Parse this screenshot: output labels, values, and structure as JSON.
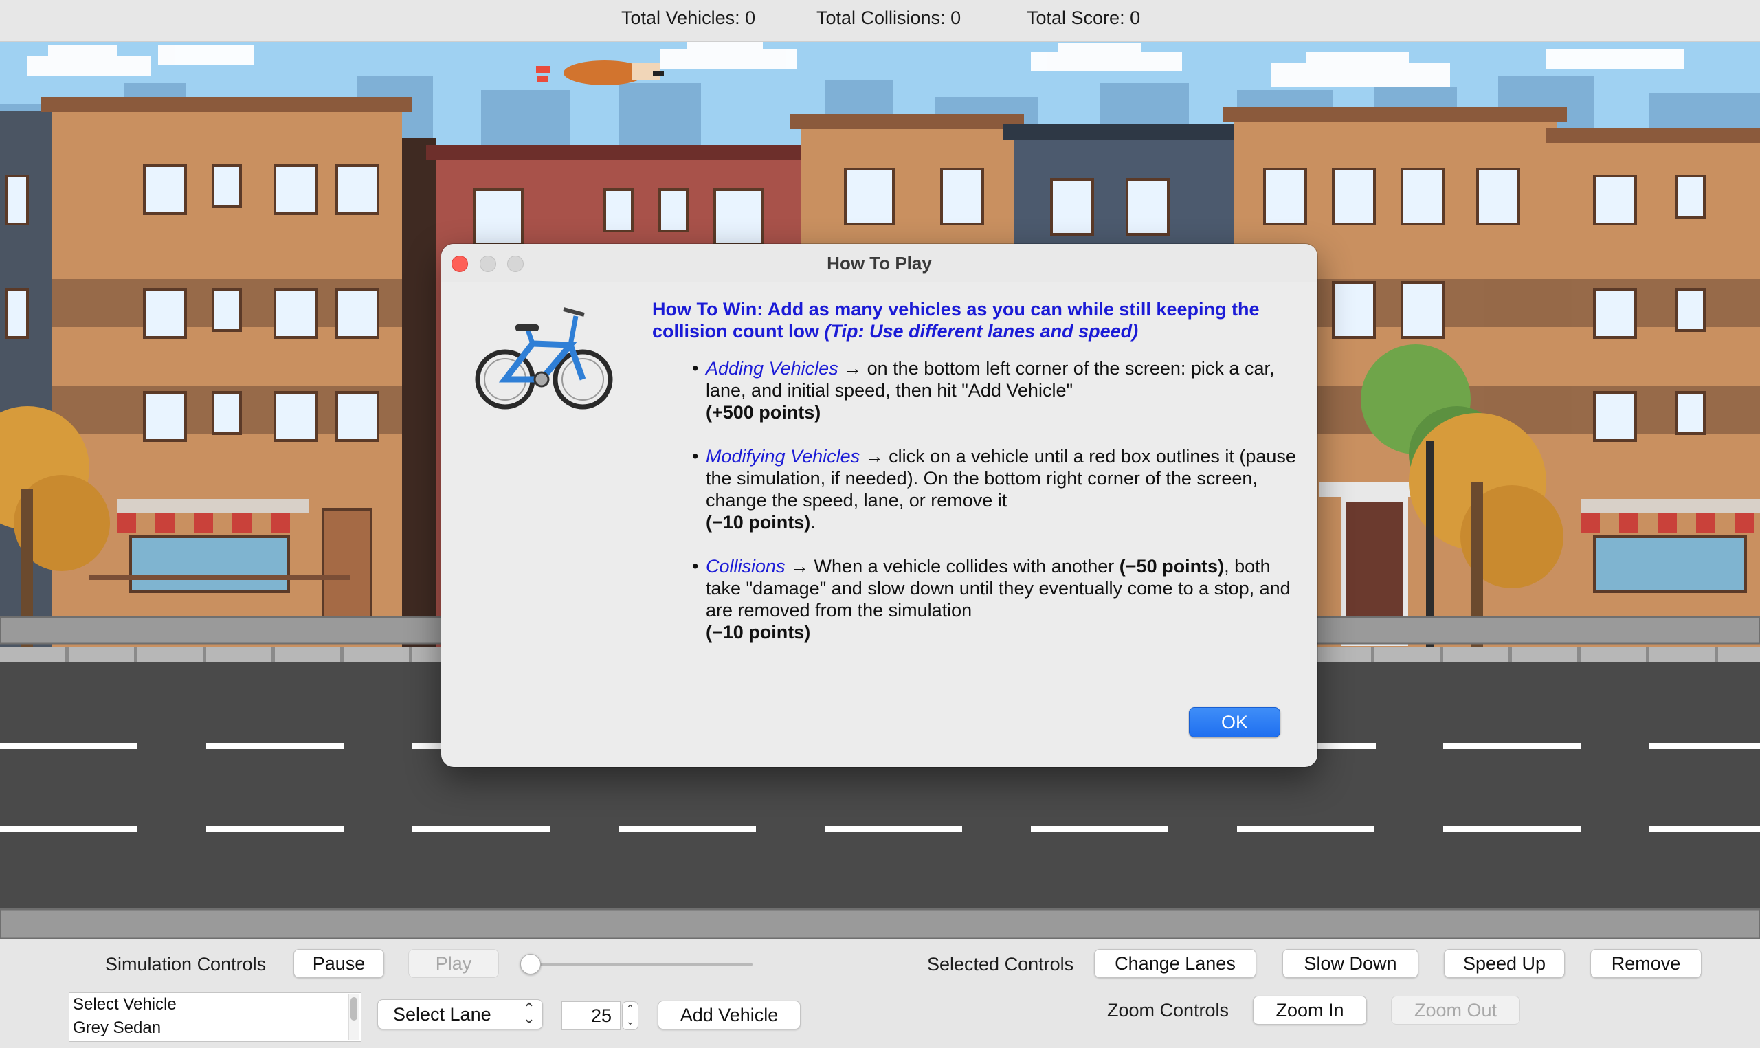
{
  "status_bar": {
    "total_vehicles": "Total Vehicles: 0",
    "total_collisions": "Total Collisions: 0",
    "total_score": "Total Score: 0"
  },
  "modal": {
    "title": "How To Play",
    "heading_main": "How To Win: Add as many vehicles as you can while still keeping the collision count low ",
    "heading_tip": "(Tip: Use different lanes and speed)",
    "bullets": [
      {
        "key": "Adding Vehicles",
        "text": " → on the bottom left corner of the screen: pick a car, lane, and initial speed, then hit \"Add Vehicle\"",
        "points": "(+500 points)"
      },
      {
        "key": "Modifying Vehicles",
        "text": " → click on a vehicle until a red box outlines it (pause the simulation, if needed). On the bottom right corner of the screen, change the speed, lane, or remove it",
        "points": "(−10 points)",
        "trail": "."
      },
      {
        "key": "Collisions",
        "text_a": " → When a vehicle collides with another ",
        "points_a": "(−50 points)",
        "text_b": ", both take \"damage\" and slow down until they eventually come to a stop, and are removed from the simulation",
        "points": "(−10 points)"
      }
    ],
    "ok_label": "OK"
  },
  "controls": {
    "simulation_label": "Simulation Controls",
    "pause_label": "Pause",
    "play_label": "Play",
    "speed_slider_value": 0,
    "vehicle_list": [
      "Select Vehicle",
      "Grey Sedan"
    ],
    "lane_select": "Select Lane",
    "speed_value": "25",
    "add_vehicle_label": "Add Vehicle",
    "selected_label": "Selected Controls",
    "change_lanes_label": "Change Lanes",
    "slow_down_label": "Slow Down",
    "speed_up_label": "Speed Up",
    "remove_label": "Remove",
    "zoom_label": "Zoom Controls",
    "zoom_in_label": "Zoom In",
    "zoom_out_label": "Zoom Out"
  },
  "colors": {
    "accent_blue": "#1b1bd6",
    "ok_button": "#2a7af5",
    "sky": "#8fc8f0",
    "road": "#4a4a4a",
    "lane_marking": "#ffffff"
  },
  "icons": {
    "modal_icon": "bicycle-icon",
    "flying_sprite": "flying-dog-sprite"
  }
}
